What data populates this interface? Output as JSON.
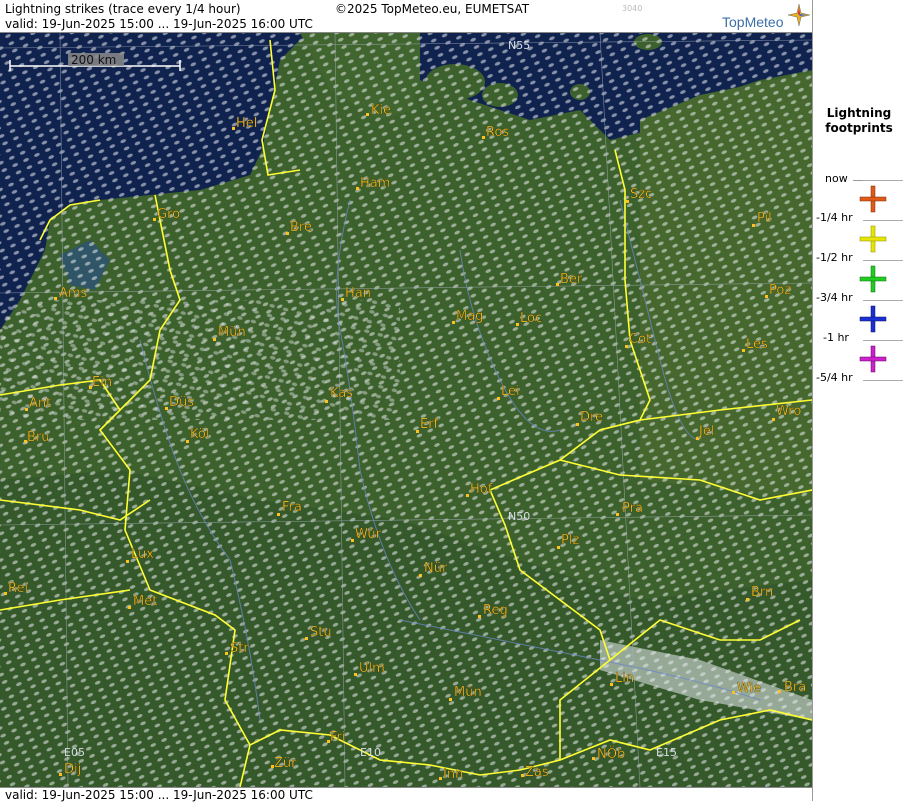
{
  "header": {
    "title": "Lightning strikes (trace every 1/4 hour)",
    "valid": "valid:  19-Jun-2025 15:00 ... 19-Jun-2025 16:00 UTC",
    "copyright": "©2025 TopMeteo.eu, EUMETSAT",
    "code": "3040",
    "logo_text": "TopMeteo"
  },
  "footer": {
    "valid": "valid:  19-Jun-2025 15:00 ... 19-Jun-2025 16:00 UTC"
  },
  "scale": {
    "label": "200 km"
  },
  "grid_labels": {
    "n55": "N55",
    "n50": "N50",
    "e05": "E05",
    "e10": "E10",
    "e15": "E15"
  },
  "cities": [
    {
      "name": "Kie"
    },
    {
      "name": "Hel"
    },
    {
      "name": "Ros"
    },
    {
      "name": "Ham"
    },
    {
      "name": "Szc"
    },
    {
      "name": "Gro"
    },
    {
      "name": "Bre"
    },
    {
      "name": "Pil"
    },
    {
      "name": "Ber"
    },
    {
      "name": "Ams"
    },
    {
      "name": "Han"
    },
    {
      "name": "Poz"
    },
    {
      "name": "Mag"
    },
    {
      "name": "Loc"
    },
    {
      "name": "Mün"
    },
    {
      "name": "Cot"
    },
    {
      "name": "Les"
    },
    {
      "name": "Ein"
    },
    {
      "name": "Kas"
    },
    {
      "name": "Lei"
    },
    {
      "name": "Ant"
    },
    {
      "name": "Düs"
    },
    {
      "name": "Wro"
    },
    {
      "name": "Erf"
    },
    {
      "name": "Dre"
    },
    {
      "name": "Bru"
    },
    {
      "name": "Köl"
    },
    {
      "name": "Jel"
    },
    {
      "name": "Hof"
    },
    {
      "name": "Fra"
    },
    {
      "name": "Pra"
    },
    {
      "name": "Wür"
    },
    {
      "name": "Lux"
    },
    {
      "name": "Plz"
    },
    {
      "name": "Rei"
    },
    {
      "name": "Nür"
    },
    {
      "name": "Met"
    },
    {
      "name": "Reg"
    },
    {
      "name": "Brn"
    },
    {
      "name": "Stu"
    },
    {
      "name": "Str"
    },
    {
      "name": "Ulm"
    },
    {
      "name": "Lin"
    },
    {
      "name": "Wie"
    },
    {
      "name": "Bra"
    },
    {
      "name": "Mün"
    },
    {
      "name": "Fri"
    },
    {
      "name": "NÖb"
    },
    {
      "name": "Dij"
    },
    {
      "name": "Zür"
    },
    {
      "name": "Inn"
    },
    {
      "name": "Zas"
    }
  ],
  "legend": {
    "title": "Lightning footprints",
    "rows": [
      {
        "label": "now",
        "color": "#e05a1a"
      },
      {
        "label": "-1/4 hr",
        "color": "#e6e600"
      },
      {
        "label": "-1/2 hr",
        "color": "#22cc22"
      },
      {
        "label": "-3/4 hr",
        "color": "#1a2fd6"
      },
      {
        "label": "-1 hr",
        "color": "#cc22cc"
      },
      {
        "label": "-5/4 hr",
        "color": ""
      }
    ]
  },
  "colors": {
    "border": "#ffff33",
    "city_label": "#ffc21a",
    "sea": "#0e1f4a",
    "land": "#3a5e2a"
  }
}
